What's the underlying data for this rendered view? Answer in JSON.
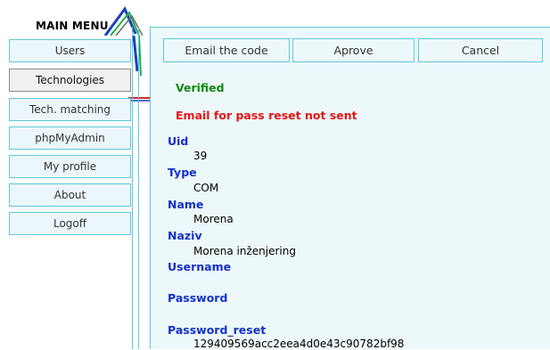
{
  "menu": {
    "title": "MAIN MENU",
    "items": [
      {
        "label": "Users"
      },
      {
        "label": "Technologies"
      },
      {
        "label": "Tech. matching"
      },
      {
        "label": "phpMyAdmin"
      },
      {
        "label": "My profile"
      },
      {
        "label": "About"
      },
      {
        "label": "Logoff"
      }
    ]
  },
  "toolbar": {
    "email_label": "Email the code",
    "approve_label": "Aprove",
    "cancel_label": "Cancel"
  },
  "status": {
    "verified": "Verified",
    "reset_message": "Email for pass reset not sent"
  },
  "fields": [
    {
      "label": "Uid",
      "value": "39"
    },
    {
      "label": "Type",
      "value": "COM"
    },
    {
      "label": "Name",
      "value": "Morena"
    },
    {
      "label": "Naziv",
      "value": "Morena inženjering"
    },
    {
      "label": "Username",
      "value": ""
    },
    {
      "label": "Password",
      "value": ""
    },
    {
      "label": "Password_reset",
      "value": "129409569acc2eea4d0e43c90782bf98"
    }
  ],
  "colors": {
    "accent": "#5cc8dc",
    "label": "#1630c8",
    "success": "#138a13",
    "error": "#e61414"
  }
}
